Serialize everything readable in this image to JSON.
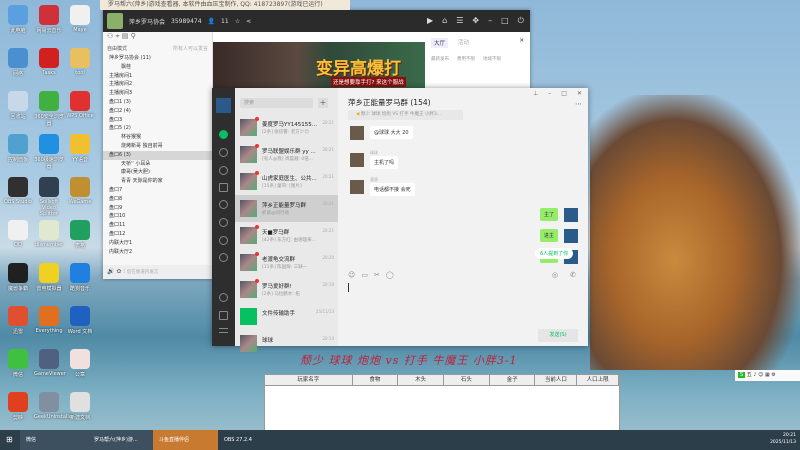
{
  "desktop": {
    "icons": [
      {
        "label": "此电脑",
        "color": "#5aa0e0"
      },
      {
        "label": "网易云音乐",
        "color": "#d0303a"
      },
      {
        "label": "Maye",
        "color": "#f0f0f0"
      },
      {
        "label": "网络",
        "color": "#4a90d0"
      },
      {
        "label": "Tasks",
        "color": "#d02020"
      },
      {
        "label": "tool",
        "color": "#e8c060"
      },
      {
        "label": "回收站",
        "color": "#c8d8e8"
      },
      {
        "label": "360安全浏览器",
        "color": "#40b040"
      },
      {
        "label": "WPS Office",
        "color": "#e03030"
      },
      {
        "label": "控制面板",
        "color": "#50a0d0"
      },
      {
        "label": "360极速浏览器",
        "color": "#2090e0"
      },
      {
        "label": "YY语音",
        "color": "#f0c030"
      },
      {
        "label": "OBS Studio",
        "color": "#303030"
      },
      {
        "label": "Sollsoft Video Splitter",
        "color": "#304050"
      },
      {
        "label": "WeGame",
        "color": "#c09030"
      },
      {
        "label": "QQ",
        "color": "#f0f0f0"
      },
      {
        "label": "dismember",
        "color": "#e0e8d0"
      },
      {
        "label": "表格",
        "color": "#20a060"
      },
      {
        "label": "魔兽争霸",
        "color": "#202020"
      },
      {
        "label": "雷电模拟器",
        "color": "#f0d020"
      },
      {
        "label": "酷狗音乐",
        "color": "#2080e0"
      },
      {
        "label": "迅雷",
        "color": "#e05030"
      },
      {
        "label": "Everything",
        "color": "#e07020"
      },
      {
        "label": "Word 文档",
        "color": "#2060c0"
      },
      {
        "label": "微信",
        "color": "#40c040"
      },
      {
        "label": "GameViewer",
        "color": "#506080"
      },
      {
        "label": "公章",
        "color": "#f0e0e0"
      },
      {
        "label": "剪映",
        "color": "#e04020"
      },
      {
        "label": "GeekUninstaller",
        "color": "#8090a0"
      },
      {
        "label": "新建文档",
        "color": "#e0e0e0"
      }
    ]
  },
  "notice_bar": {
    "text": "罗马帮六(萍乡)游戏查看器, 本软件由血压宝制作, QQ: 418723897(游戏已运行)"
  },
  "yy": {
    "channel_name": "萍乡罗马协会",
    "channel_id": "35989474",
    "online_count": "11",
    "mode_label": "自由模式",
    "mode_hint": "所有人可以发言",
    "tree": [
      {
        "label": "萍乡罗马协会 (11)",
        "level": 1
      },
      {
        "label": "飘荏",
        "level": 2
      },
      {
        "label": "主播房间1",
        "level": 1
      },
      {
        "label": "主播房间2",
        "level": 1
      },
      {
        "label": "主播房间3",
        "level": 1
      },
      {
        "label": "盘口1 (3)",
        "level": 1
      },
      {
        "label": "盘口2 (4)",
        "level": 1
      },
      {
        "label": "盘口3",
        "level": 1
      },
      {
        "label": "盘口5 (2)",
        "level": 1
      },
      {
        "label": "林谷猴猴",
        "level": 2
      },
      {
        "label": "烧烤新哥  独自前哥",
        "level": 2
      },
      {
        "label": "盘口6 (3)",
        "level": 1,
        "selected": true
      },
      {
        "label": "天桥'' 小耳朵",
        "level": 2
      },
      {
        "label": "康哥(吴大胆)",
        "level": 2
      },
      {
        "label": "青青  天际是你的家",
        "level": 2
      },
      {
        "label": "盘口7",
        "level": 1
      },
      {
        "label": "盘口8",
        "level": 1
      },
      {
        "label": "盘口9",
        "level": 1
      },
      {
        "label": "盘口10",
        "level": 1
      },
      {
        "label": "盘口11",
        "level": 1
      },
      {
        "label": "盘口12",
        "level": 1
      },
      {
        "label": "内联大厅1",
        "level": 1
      },
      {
        "label": "内联大厅2",
        "level": 1
      }
    ],
    "bottom_hint": "您在频道内发言",
    "banner_title": "变异高爆打",
    "banner_sub": "还是想要靠手打? 来这个服战",
    "right_tabs": [
      "大厅",
      "活动"
    ],
    "filters": [
      "最新发布",
      "费用不限",
      "地域不限"
    ]
  },
  "wechat": {
    "search_placeholder": "搜索",
    "chats": [
      {
        "name": "姜度罗马YY145155...",
        "preview": "[2条] 张侦警: 老方少😊",
        "time": "20:21",
        "unread": true
      },
      {
        "name": "罗马联盟娱乐群 yy ...",
        "preview": "[有人@我] 周磊顺: 0倍...",
        "time": "20:21",
        "unread": true
      },
      {
        "name": "山虎家庭医生、公共...",
        "preview": "[15条] 童哥: [图片]",
        "time": "20:21",
        "unread": true
      },
      {
        "name": "萍乡正能量罗马群",
        "preview": "抓紧@同行地",
        "time": "20:21",
        "unread": false,
        "active": true
      },
      {
        "name": "天■罗马群",
        "preview": "[42条] 东方红: 由德理来...",
        "time": "20:21",
        "unread": true
      },
      {
        "name": "老渡龟交流群",
        "preview": "[11条] 陈国辉: 三缺一",
        "time": "20:20",
        "unread": true
      },
      {
        "name": "罗马爱好群!",
        "preview": "[2条] 马拉鹏水: 拓",
        "time": "20:19",
        "unread": true
      },
      {
        "name": "文件传输助手",
        "preview": "",
        "time": "25/11/13",
        "unread": false
      },
      {
        "name": "球球",
        "preview": "",
        "time": "20:14",
        "unread": false
      }
    ],
    "title": "萍乡正能量罗马群 (154)",
    "pinned_notice": "颓少 球球 炮炮 VS 打手 牛魔王 小胖3...",
    "messages": [
      {
        "sender": "",
        "text": "@球球 大大 20",
        "me": false
      },
      {
        "sender": "球球",
        "text": "主机了吗",
        "me": false
      },
      {
        "sender": "滚滚",
        "text": "电话都不接 会死",
        "me": false
      },
      {
        "sender": "",
        "text": "主了",
        "me": true
      },
      {
        "sender": "",
        "text": "进主",
        "me": true
      },
      {
        "sender": "",
        "text": "抓紧",
        "me": true
      }
    ],
    "mention_tip": "6人提到了你",
    "send_label": "发送(S)"
  },
  "overlay": {
    "match_title": "颓少  球球  炮炮  vs  打手  牛魔王  小胖3-1"
  },
  "stats_table": {
    "columns": [
      "玩家名字",
      "食物",
      "木头",
      "石头",
      "金子",
      "当前人口",
      "人口上限"
    ]
  },
  "ime": {
    "label": "五"
  },
  "taskbar": {
    "items": [
      "微信",
      "罗马帮六(萍乡)游...",
      "斗鱼直播伴侣",
      "OBS 27.2.4"
    ],
    "time": "20:21",
    "date": "2025/11/13"
  }
}
